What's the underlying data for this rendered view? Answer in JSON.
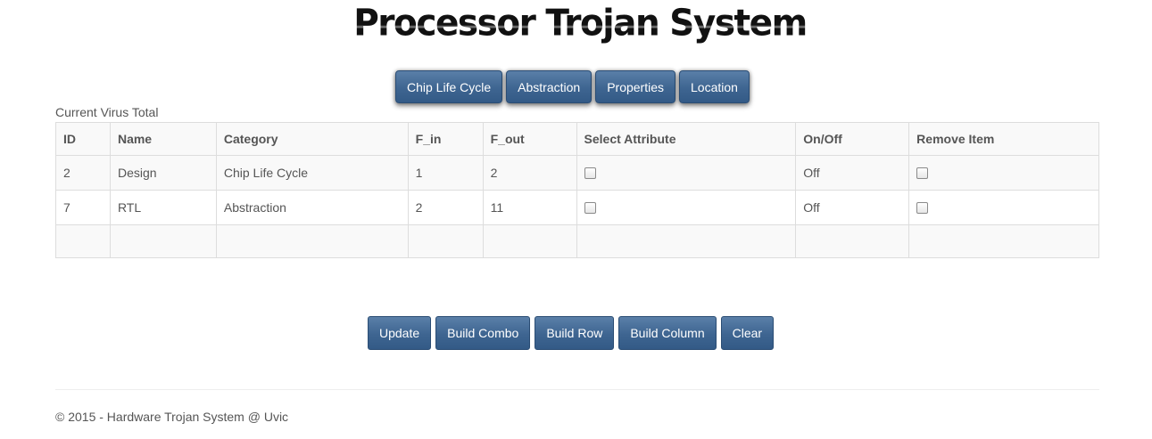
{
  "header": {
    "title": "Processor Trojan System"
  },
  "nav": {
    "buttons": [
      "Chip Life Cycle",
      "Abstraction",
      "Properties",
      "Location"
    ]
  },
  "table": {
    "caption": "Current Virus Total",
    "columns": [
      "ID",
      "Name",
      "Category",
      "F_in",
      "F_out",
      "Select Attribute",
      "On/Off",
      "Remove Item"
    ],
    "rows": [
      {
        "id": "2",
        "name": "Design",
        "category": "Chip Life Cycle",
        "f_in": "1",
        "f_out": "2",
        "select_attribute": false,
        "on_off": "Off",
        "remove_item": false
      },
      {
        "id": "7",
        "name": "RTL",
        "category": "Abstraction",
        "f_in": "2",
        "f_out": "11",
        "select_attribute": false,
        "on_off": "Off",
        "remove_item": false
      }
    ]
  },
  "actions": {
    "buttons": [
      "Update",
      "Build Combo",
      "Build Row",
      "Build Column",
      "Clear"
    ]
  },
  "footer": {
    "text": "© 2015 - Hardware Trojan System @ Uvic"
  },
  "colors": {
    "button_blue": "#3e6591",
    "border": "#dddddd",
    "stripe": "#f9f9f9"
  }
}
